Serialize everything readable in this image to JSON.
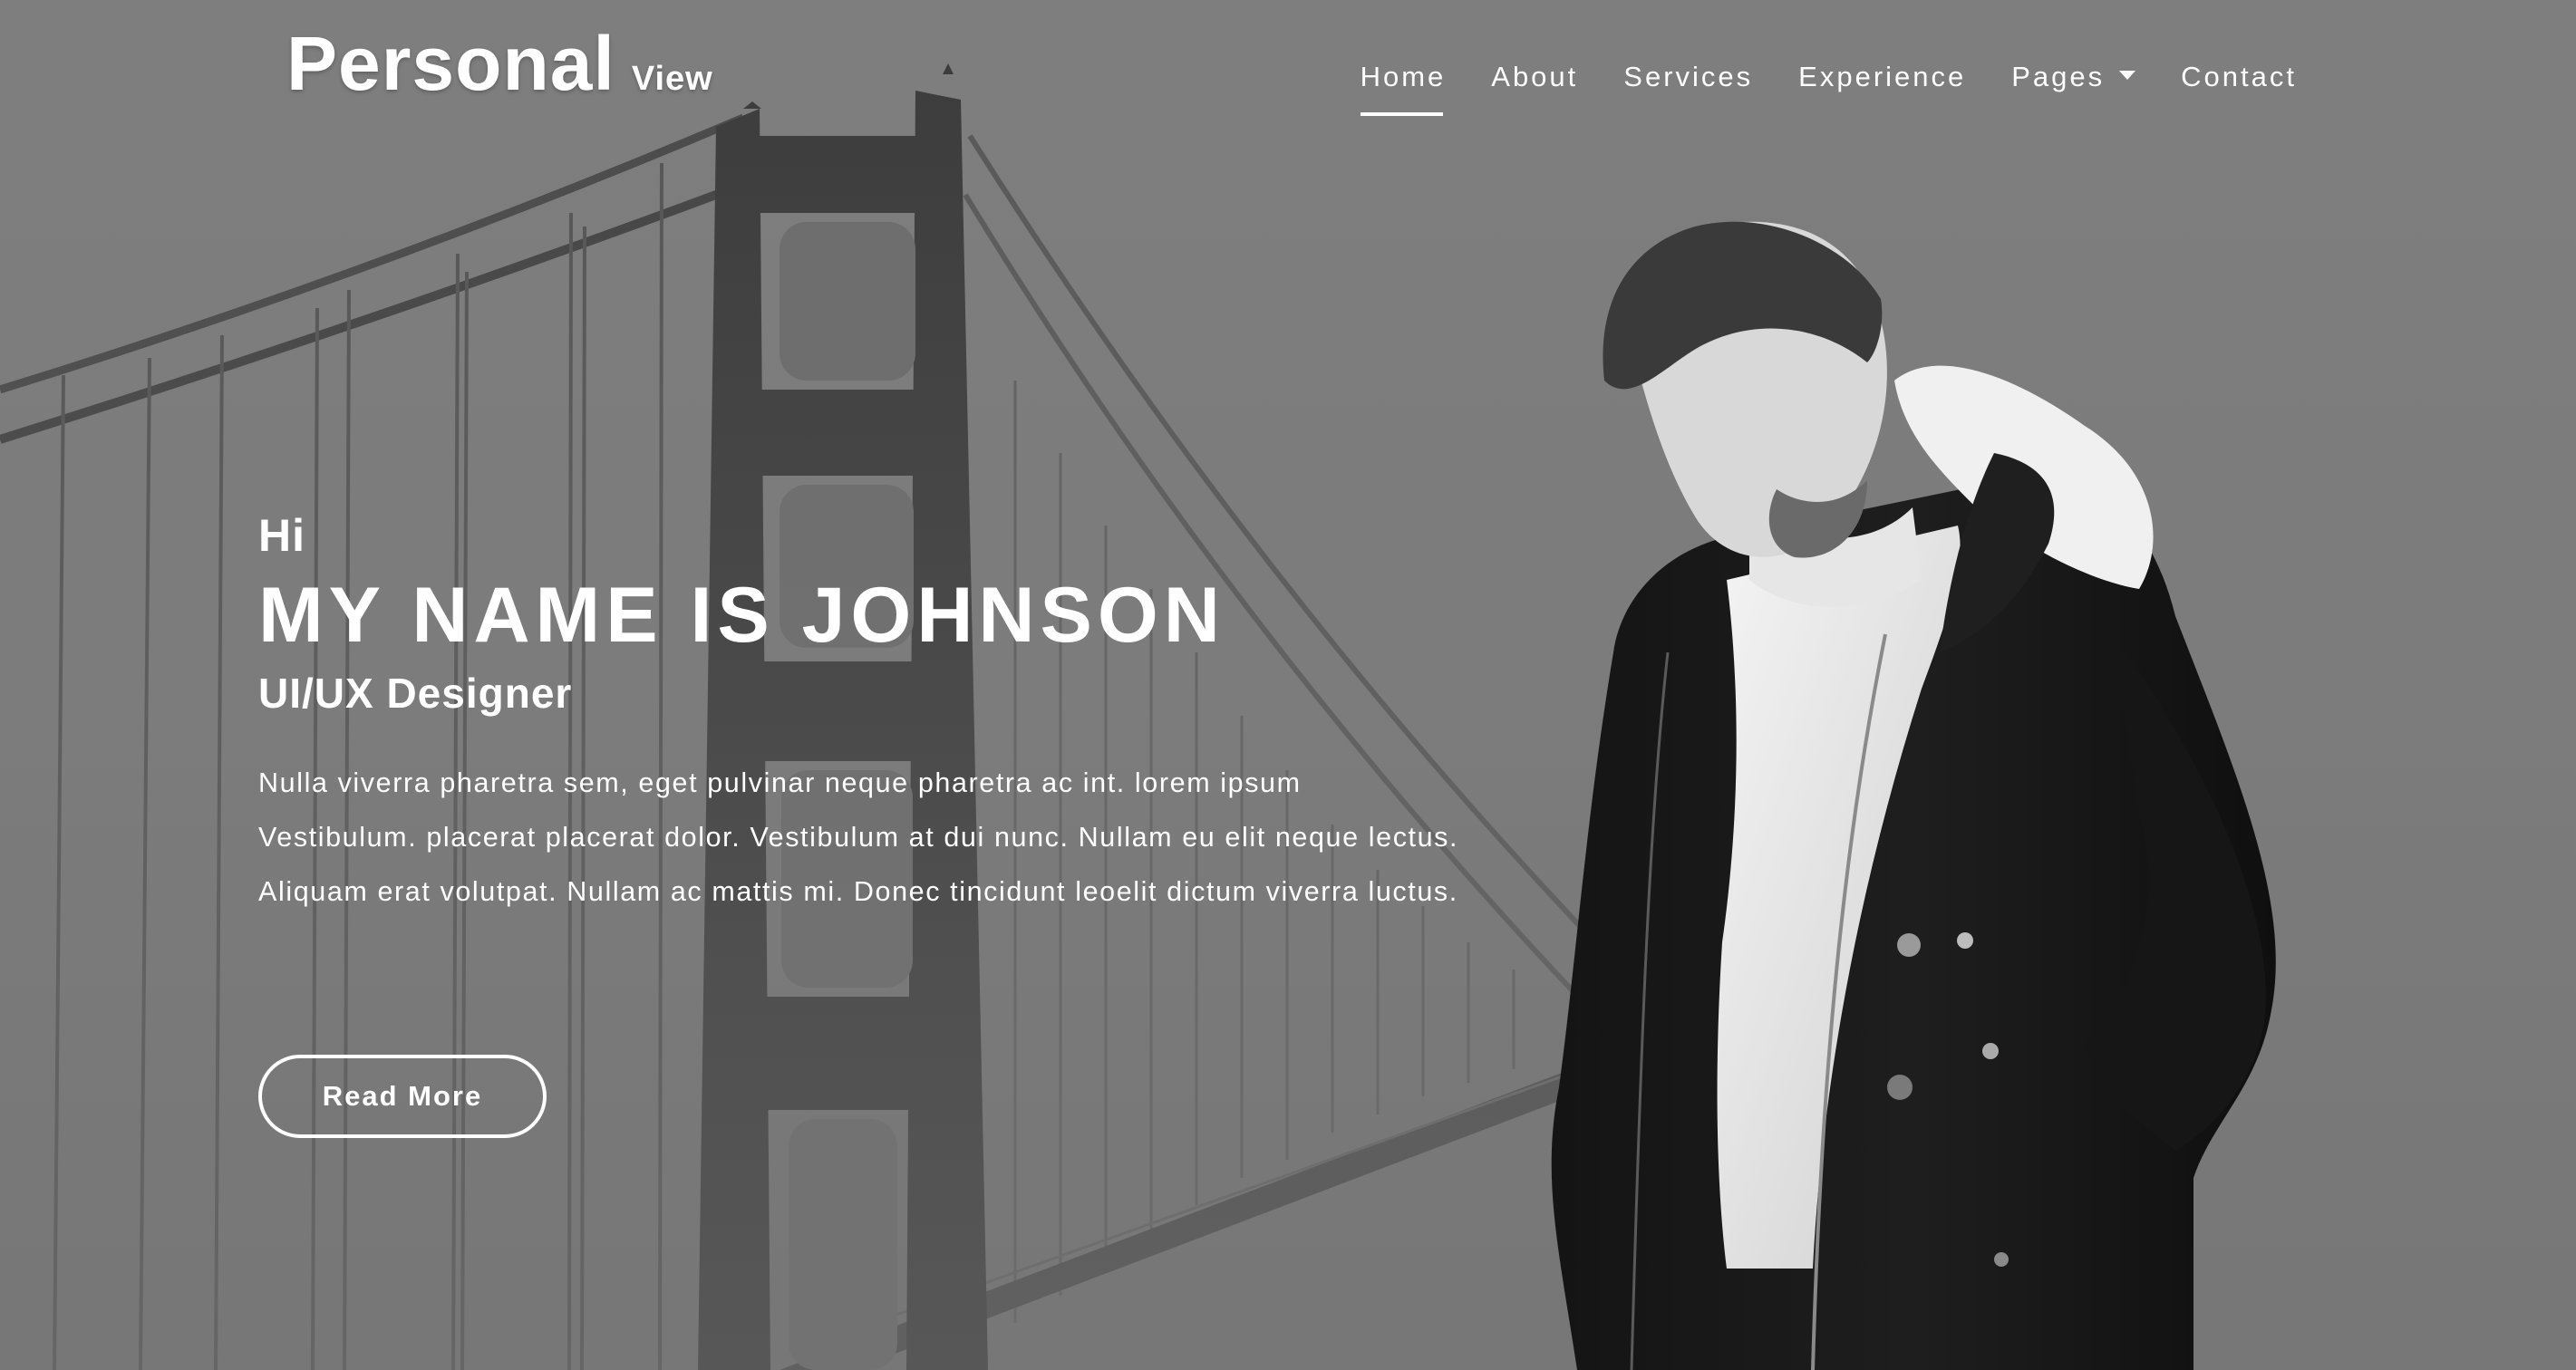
{
  "brand": {
    "main": "Personal",
    "sub": "View"
  },
  "nav": {
    "items": [
      {
        "label": "Home",
        "active": true
      },
      {
        "label": "About"
      },
      {
        "label": "Services"
      },
      {
        "label": "Experience"
      },
      {
        "label": "Pages",
        "dropdown": true
      },
      {
        "label": "Contact"
      }
    ]
  },
  "hero": {
    "greeting": "Hi",
    "name": "MY NAME IS JOHNSON",
    "role": "UI/UX Designer",
    "description": "Nulla viverra pharetra sem, eget pulvinar neque pharetra ac int. lorem ipsum Vestibulum. placerat placerat dolor. Vestibulum at dui nunc. Nullam eu elit neque lectus. Aliquam erat volutpat. Nullam ac mattis mi. Donec tincidunt leoelit dictum viverra luctus.",
    "button_label": "Read More"
  },
  "icons": {
    "dropdown": "chevron-down-icon"
  },
  "colors": {
    "background": "#7d7d7d",
    "text": "#ffffff"
  }
}
